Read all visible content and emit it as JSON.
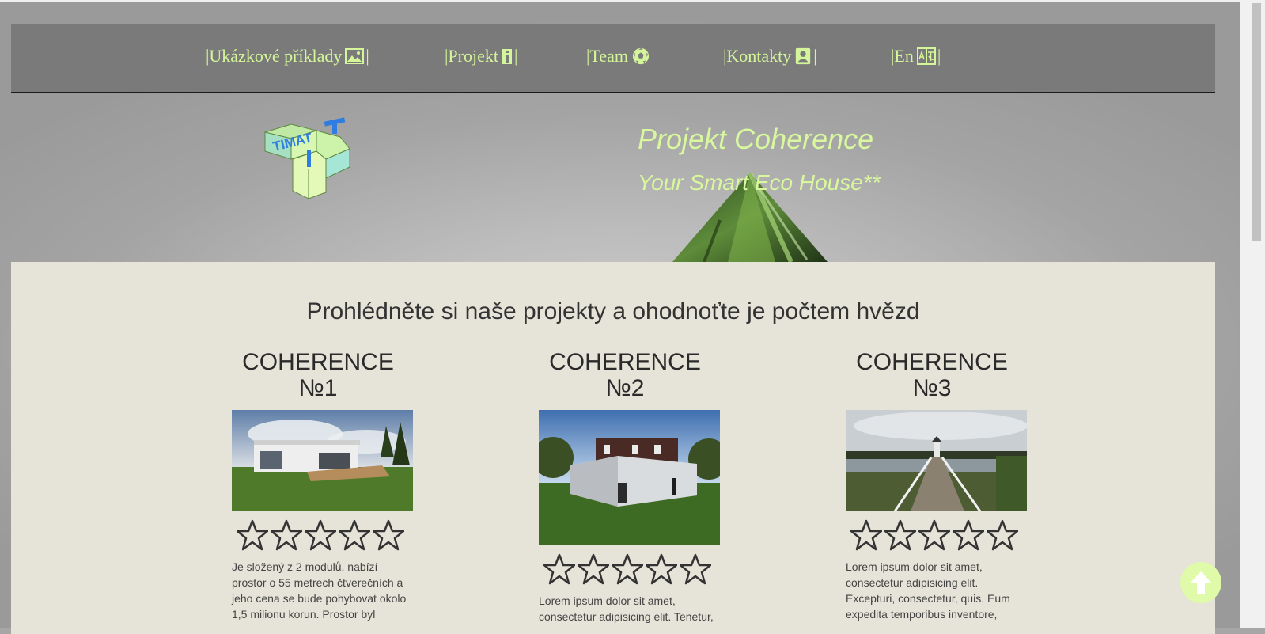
{
  "nav": {
    "items": [
      {
        "label": "|Ukázkové příklady",
        "suffix": "|",
        "icon": "image-icon"
      },
      {
        "label": "|Projekt ",
        "suffix": "|",
        "icon": "info-icon"
      },
      {
        "label": "|Team ",
        "suffix": "",
        "icon": "soccer-ball-icon"
      },
      {
        "label": "|Kontakty ",
        "suffix": "|",
        "icon": "contact-card-icon"
      },
      {
        "label": "|En ",
        "suffix": "|",
        "icon": "language-icon"
      }
    ]
  },
  "hero": {
    "logo_text": "TIMAT",
    "title": "Projekt Coherence",
    "subtitle": "Your Smart Eco House**"
  },
  "main": {
    "heading": "Prohlédněte si naše projekty a ohodnoťte je počtem hvězd",
    "projects": [
      {
        "title_line1": "COHERENCE",
        "title_line2": "№1",
        "rating": 0,
        "max_rating": 5,
        "text": "Je složený z 2 modulů, nabízí prostor o 55 metrech čtverečních a jeho cena se bude pohybovat okolo 1,5 milionu korun. Prostor byl"
      },
      {
        "title_line1": "COHERENCE",
        "title_line2": "№2",
        "rating": 0,
        "max_rating": 5,
        "text": "Lorem ipsum dolor sit amet, consectetur adipisicing elit. Tenetur,"
      },
      {
        "title_line1": "COHERENCE",
        "title_line2": "№3",
        "rating": 0,
        "max_rating": 5,
        "text": "Lorem ipsum dolor sit amet, consectetur adipisicing elit. Excepturi, consectetur, quis. Eum expedita temporibus inventore,"
      }
    ]
  },
  "colors": {
    "accent": "#d8f79e",
    "navbar": "#7a7a7a",
    "content_bg": "#e6e4d8"
  },
  "scroll_top": {
    "icon": "arrow-up-circle-icon"
  }
}
